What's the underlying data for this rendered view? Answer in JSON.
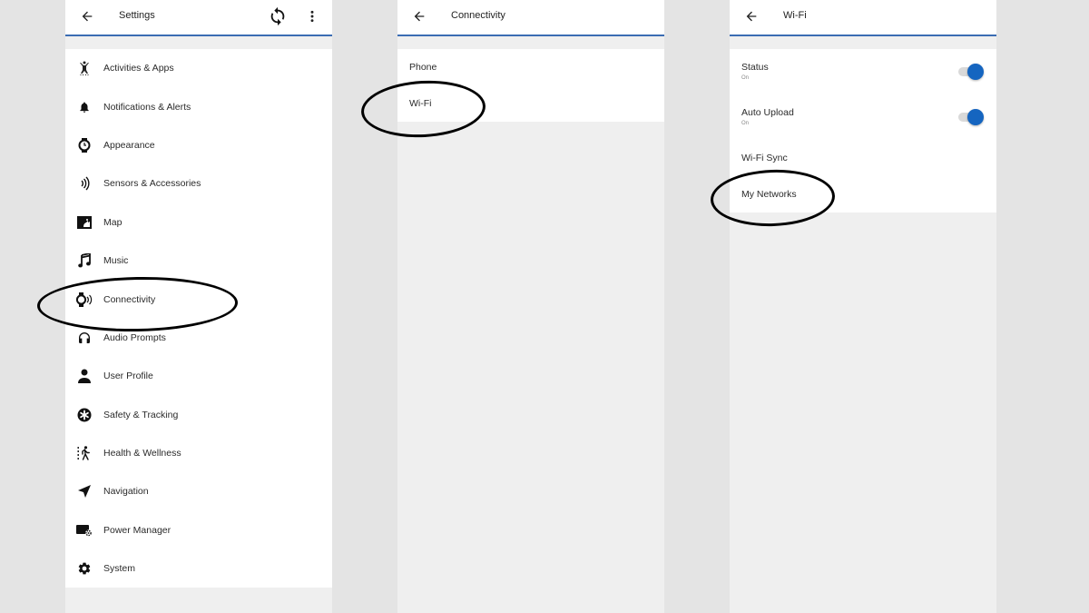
{
  "colors": {
    "accent": "#3b6db3",
    "toggle_on": "#1565c0",
    "page_bg": "#e4e4e4",
    "panel_bg": "#efefef"
  },
  "settings_screen": {
    "title": "Settings",
    "back_icon": "arrow-left-icon",
    "actions": [
      {
        "name": "sync",
        "icon": "sync-icon"
      },
      {
        "name": "more",
        "icon": "more-vert-icon"
      }
    ],
    "items": [
      {
        "label": "Activities & Apps",
        "icon": "activities-icon"
      },
      {
        "label": "Notifications & Alerts",
        "icon": "bell-icon"
      },
      {
        "label": "Appearance",
        "icon": "watch-icon"
      },
      {
        "label": "Sensors & Accessories",
        "icon": "sensor-waves-icon"
      },
      {
        "label": "Map",
        "icon": "map-icon"
      },
      {
        "label": "Music",
        "icon": "music-note-icon"
      },
      {
        "label": "Connectivity",
        "icon": "watch-connectivity-icon"
      },
      {
        "label": "Audio Prompts",
        "icon": "headphones-icon"
      },
      {
        "label": "User Profile",
        "icon": "person-icon"
      },
      {
        "label": "Safety & Tracking",
        "icon": "safety-asterisk-icon"
      },
      {
        "label": "Health & Wellness",
        "icon": "walking-icon"
      },
      {
        "label": "Navigation",
        "icon": "navigation-arrow-icon"
      },
      {
        "label": "Power Manager",
        "icon": "power-manager-icon"
      },
      {
        "label": "System",
        "icon": "gear-icon"
      }
    ]
  },
  "connectivity_screen": {
    "title": "Connectivity",
    "back_icon": "arrow-left-icon",
    "items": [
      {
        "label": "Phone"
      },
      {
        "label": "Wi-Fi"
      }
    ]
  },
  "wifi_screen": {
    "title": "Wi-Fi",
    "back_icon": "arrow-left-icon",
    "toggles": [
      {
        "label": "Status",
        "sub": "On",
        "checked": true
      },
      {
        "label": "Auto Upload",
        "sub": "On",
        "checked": true
      }
    ],
    "items": [
      {
        "label": "Wi-Fi Sync"
      },
      {
        "label": "My Networks"
      }
    ]
  },
  "annotations": [
    {
      "target": "Connectivity",
      "shape": "ellipse"
    },
    {
      "target": "Wi-Fi",
      "shape": "ellipse"
    },
    {
      "target": "My Networks",
      "shape": "ellipse"
    }
  ]
}
